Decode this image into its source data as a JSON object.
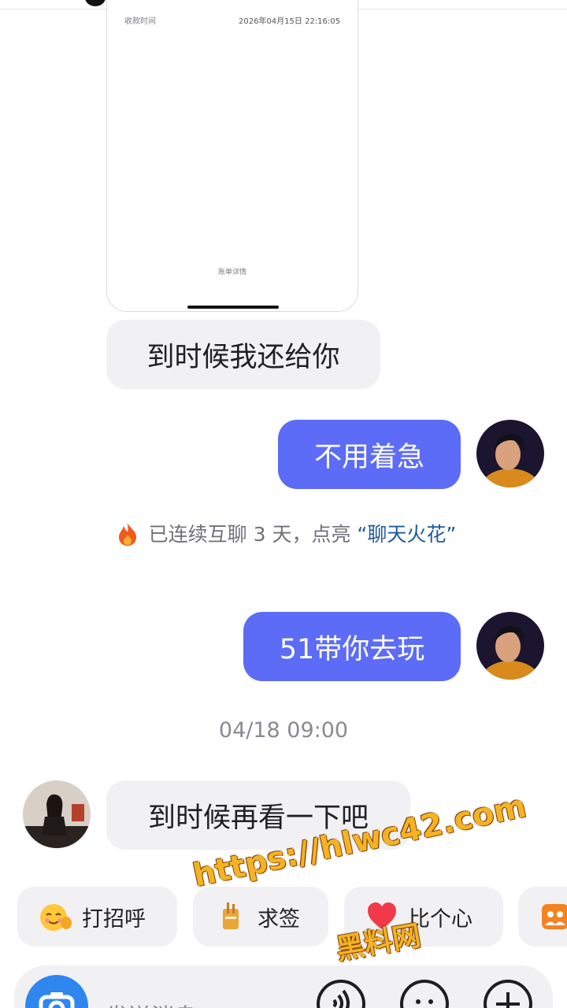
{
  "payment_card": {
    "time_label": "收款时间",
    "time_value": "2026年04月15日 22:16:05",
    "detail_link": "账单详情"
  },
  "messages": [
    {
      "direction": "in",
      "text": "到时候我还给你"
    },
    {
      "direction": "out",
      "text": "不用着急"
    },
    {
      "direction": "out",
      "text": "51带你去玩"
    },
    {
      "direction": "in",
      "text": "到时候再看一下吧"
    }
  ],
  "streak_notice": {
    "prefix": "已连续互聊 3 天，点亮 ",
    "highlight": "“聊天火花”"
  },
  "timestamp": "04/18 09:00",
  "quick_replies": [
    {
      "label": "打招呼",
      "icon": "smile-wave-icon"
    },
    {
      "label": "求签",
      "icon": "fortune-icon"
    },
    {
      "label": "比个心",
      "icon": "heart-icon"
    },
    {
      "label": "",
      "icon": "group-icon"
    }
  ],
  "input_bar": {
    "placeholder": "发送消息"
  },
  "watermark": {
    "line1": "https://hlwc42.com",
    "line2": "黑料网"
  },
  "colors": {
    "outgoing_bubble": "#5c6cf6",
    "incoming_bubble": "#f1f1f4",
    "streak_highlight": "#1e5a9e",
    "camera_button": "#2f86ee"
  }
}
